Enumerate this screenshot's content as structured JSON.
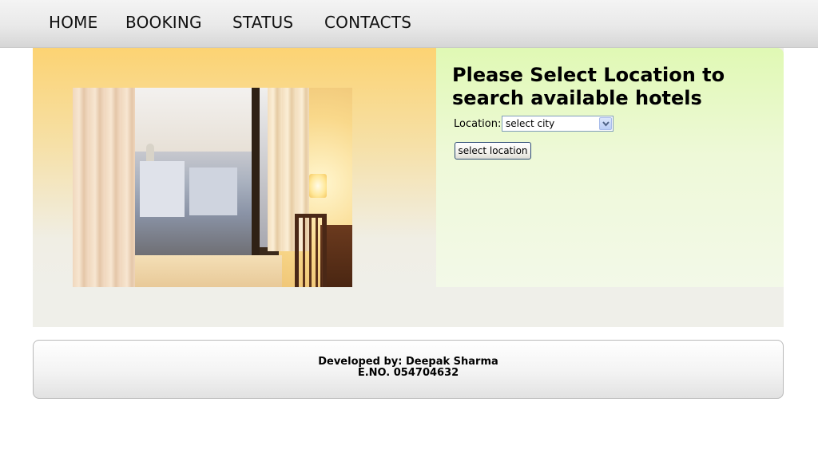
{
  "nav": {
    "items": [
      {
        "label": "HOME"
      },
      {
        "label": "BOOKING"
      },
      {
        "label": "STATUS"
      },
      {
        "label": "CONTACTS"
      }
    ]
  },
  "search": {
    "title": "Please Select Location to search available hotels",
    "location_label": "Location:",
    "city_select": {
      "selected": "select city"
    },
    "submit_label": "select location"
  },
  "footer": {
    "developer": "Developed by: Deepak Sharma",
    "enrollment": "E.NO. 054704632"
  },
  "colors": {
    "left_pane_top": "#fcd373",
    "right_pane_top": "#e0f9b4",
    "main_bg": "#efefe9"
  },
  "icons": {
    "select_arrow": "chevron-down-icon"
  }
}
